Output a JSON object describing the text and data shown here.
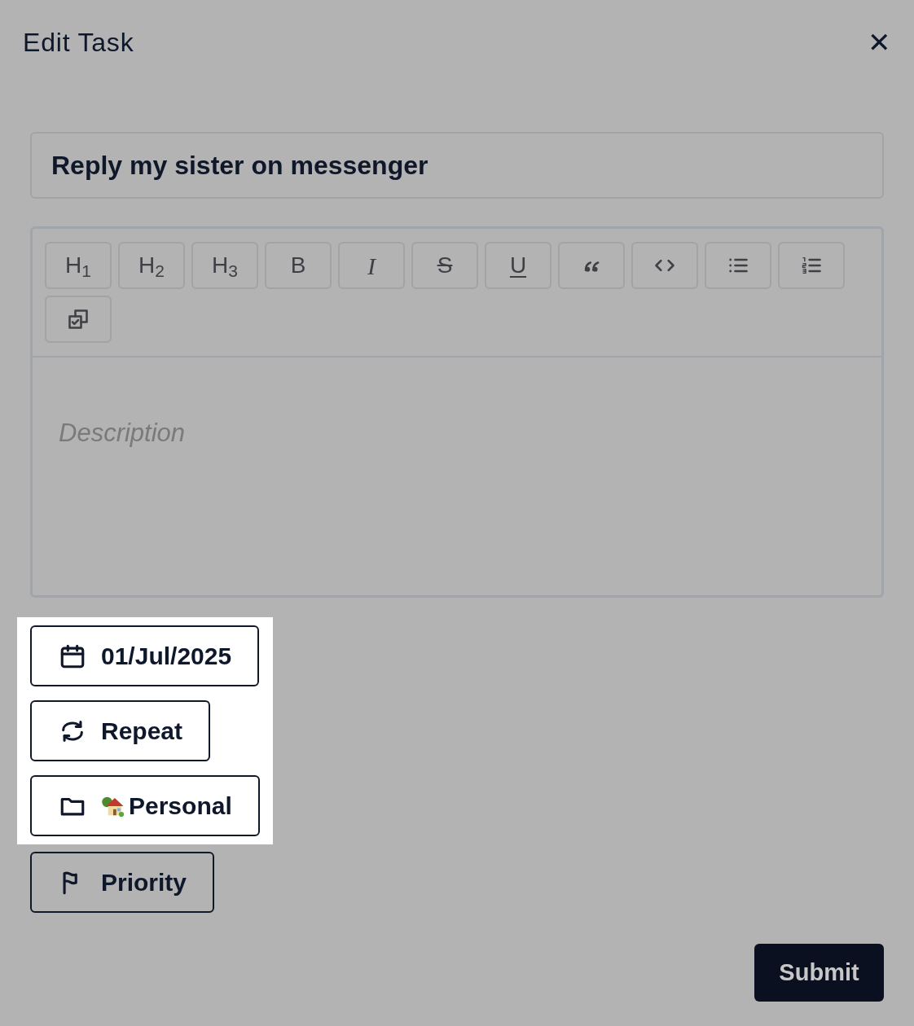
{
  "dialog": {
    "title": "Edit Task",
    "close_label": "✕"
  },
  "task_title": {
    "value": "Reply my sister on messenger"
  },
  "toolbar": [
    {
      "kind": "heading",
      "label": "H$_{1}$"
    },
    {
      "kind": "heading",
      "label": "H$_{2}$"
    },
    {
      "kind": "heading",
      "label": "H$_{3}$"
    },
    {
      "kind": "bold",
      "label": "B"
    },
    {
      "kind": "italic",
      "label": "I"
    },
    {
      "kind": "strike",
      "label": "S"
    },
    {
      "kind": "underline",
      "label": "U"
    },
    {
      "kind": "quote"
    },
    {
      "kind": "code"
    },
    {
      "kind": "bullet-list"
    },
    {
      "kind": "ordered-list"
    },
    {
      "kind": "checklist"
    }
  ],
  "description": {
    "placeholder": "Description"
  },
  "actions": [
    {
      "kind": "date",
      "label": "01/Jul/2025",
      "highlighted": true
    },
    {
      "kind": "repeat",
      "label": "Repeat",
      "highlighted": true
    },
    {
      "kind": "project",
      "label": "Personal",
      "highlighted": true
    },
    {
      "kind": "priority",
      "label": "Priority",
      "highlighted": false
    }
  ],
  "submit": "Submit"
}
